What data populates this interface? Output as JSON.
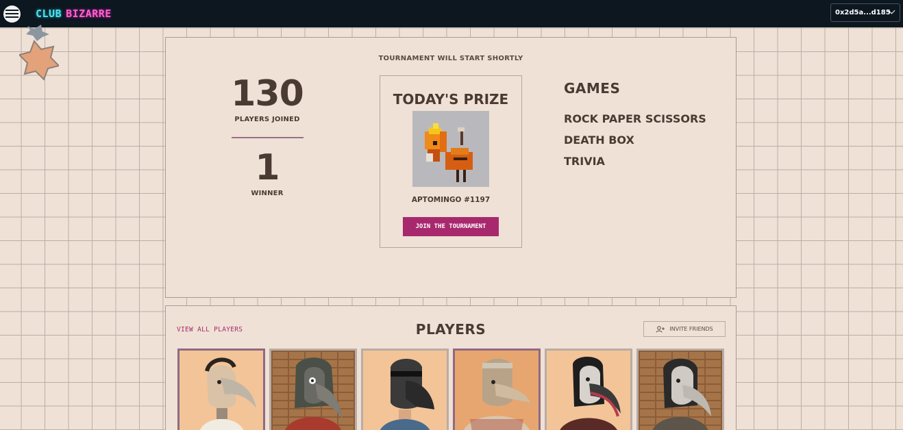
{
  "header": {
    "logo_part1": "CLUB",
    "logo_part2": "BIZARRE",
    "wallet_address": "0x2d5a...d185",
    "icons": [
      "menu-icon",
      "chevron-down-icon"
    ]
  },
  "tournament": {
    "status": "TOURNAMENT WILL START SHORTLY",
    "players_joined_count": "130",
    "players_joined_label": "PLAYERS JOINED",
    "winner_count": "1",
    "winner_label": "WINNER",
    "prize_title": "TODAY'S PRIZE",
    "prize_name": "APTOMINGO #1197",
    "join_label": "JOIN THE TOURNAMENT",
    "games_title": "GAMES",
    "games": [
      "ROCK PAPER SCISSORS",
      "DEATH BOX",
      "TRIVIA"
    ]
  },
  "players": {
    "view_all": "VIEW ALL PLAYERS",
    "title": "PLAYERS",
    "invite_label": "INVITE FRIENDS",
    "invite_icon": "add-user-icon"
  },
  "colors": {
    "accent": "#a8286d",
    "background": "#efe1d6",
    "topbar": "#0c1720",
    "text": "#4a3a31"
  }
}
